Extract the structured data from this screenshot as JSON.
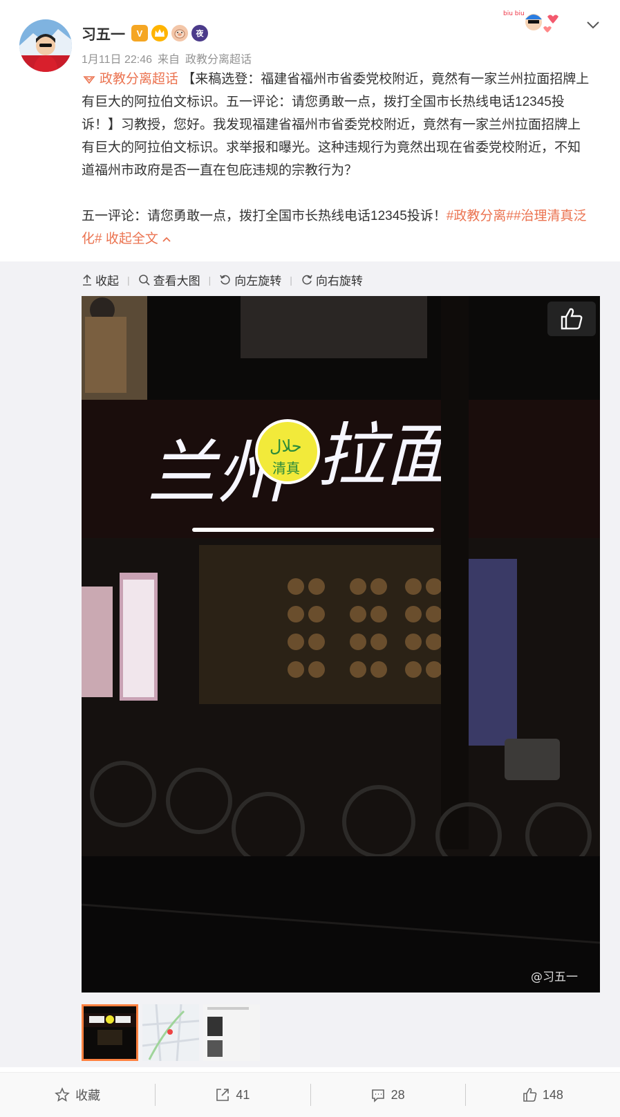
{
  "post": {
    "author": "习五一",
    "badges": [
      "V",
      "crown",
      "pig",
      "夜"
    ],
    "time": "1月11日 22:46",
    "source_prefix": "来自",
    "source": "政教分离超话",
    "topic_tag": "政教分离超话",
    "body_p1": "【来稿选登：福建省福州市省委党校附近，竟然有一家兰州拉面招牌上有巨大的阿拉伯文标识。五一评论：请您勇敢一点，拨打全国市长热线电话12345投诉！】习教授，您好。我发现福建省福州市省委党校附近，竟然有一家兰州拉面招牌上有巨大的阿拉伯文标识。求举报和曝光。这种违规行为竟然出现在省委党校附近，不知道福州市政府是否一直在包庇违规的宗教行为？",
    "body_p2": "五一评论：请您勇敢一点，拨打全国市长热线电话12345投诉！",
    "hashtag1": "#政教分离#",
    "hashtag2": "#治理清真泛化#",
    "collapse_label": "收起全文",
    "sticker_text": "biu biu"
  },
  "toolbar": {
    "collapse": "收起",
    "view_large": "查看大图",
    "rotate_left": "向左旋转",
    "rotate_right": "向右旋转"
  },
  "photo": {
    "sign_left": "兰州",
    "sign_right": "拉面",
    "halal_arabic": "حلال",
    "halal_cn": "清真",
    "watermark": "@习五一"
  },
  "actions": {
    "favorite": "收藏",
    "repost_count": "41",
    "comment_count": "28",
    "like_count": "148"
  },
  "colors": {
    "accent": "#eb7350",
    "thumb_border": "#ff8140",
    "meta_gray": "#939393"
  }
}
